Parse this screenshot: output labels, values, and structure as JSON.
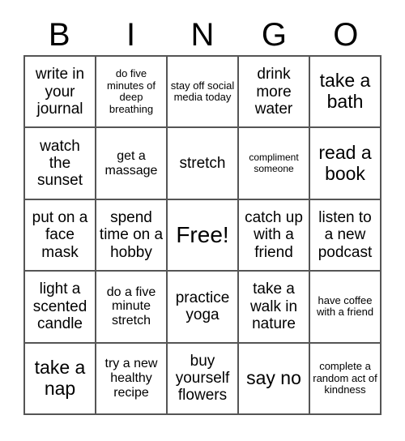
{
  "header": {
    "letters": [
      "B",
      "I",
      "N",
      "G",
      "O"
    ]
  },
  "grid": {
    "rows": 5,
    "columns": 5,
    "border_color": "#555555",
    "background_color": "#ffffff",
    "text_color": "#000000",
    "cells": [
      {
        "text": "write in your journal",
        "size": "fs-md"
      },
      {
        "text": "do five minutes of deep breathing",
        "size": "fs-xs"
      },
      {
        "text": "stay off social media today",
        "size": "fs-xs"
      },
      {
        "text": "drink more water",
        "size": "fs-md"
      },
      {
        "text": "take a bath",
        "size": "fs-lg"
      },
      {
        "text": "watch the sunset",
        "size": "fs-md"
      },
      {
        "text": "get a massage",
        "size": "fs-sm"
      },
      {
        "text": "stretch",
        "size": "fs-md"
      },
      {
        "text": "compliment someone",
        "size": "fs-xxs"
      },
      {
        "text": "read a book",
        "size": "fs-lg"
      },
      {
        "text": "put on a face mask",
        "size": "fs-md"
      },
      {
        "text": "spend time on a hobby",
        "size": "fs-md"
      },
      {
        "text": "Free!",
        "size": "fs-xl"
      },
      {
        "text": "catch up with a friend",
        "size": "fs-md"
      },
      {
        "text": "listen to a new podcast",
        "size": "fs-md"
      },
      {
        "text": "light a scented candle",
        "size": "fs-md"
      },
      {
        "text": "do a five minute stretch",
        "size": "fs-sm"
      },
      {
        "text": "practice yoga",
        "size": "fs-md"
      },
      {
        "text": "take a walk in nature",
        "size": "fs-md"
      },
      {
        "text": "have coffee with a friend",
        "size": "fs-xs"
      },
      {
        "text": "take a nap",
        "size": "fs-lg"
      },
      {
        "text": "try a new healthy recipe",
        "size": "fs-sm"
      },
      {
        "text": "buy yourself flowers",
        "size": "fs-md"
      },
      {
        "text": "say no",
        "size": "fs-lg"
      },
      {
        "text": "complete a random act of kindness",
        "size": "fs-xs"
      }
    ]
  }
}
